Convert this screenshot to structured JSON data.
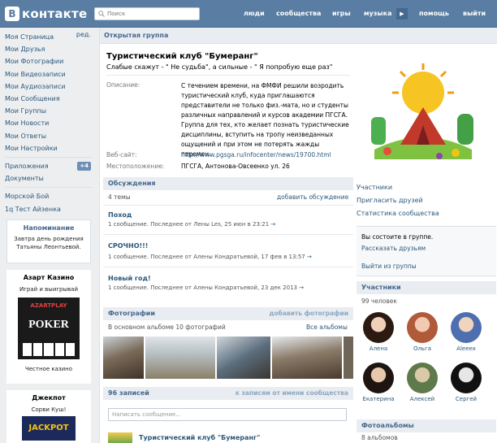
{
  "header": {
    "logo_letter": "В",
    "logo_text": "контакте",
    "search_placeholder": "Поиск",
    "nav": [
      "люди",
      "сообщества",
      "игры",
      "музыка",
      "помощь",
      "выйти"
    ]
  },
  "sidebar": {
    "items": [
      "Моя Страница",
      "Мои Друзья",
      "Мои Фотографии",
      "Мои Видеозаписи",
      "Мои Аудиозаписи",
      "Мои Сообщения",
      "Мои Группы",
      "Мои Новости",
      "Мои Ответы",
      "Мои Настройки"
    ],
    "edit_label": "ред.",
    "apps": [
      "Приложения",
      "Документы"
    ],
    "apps_badge": "+4",
    "games": [
      "Морской Бой",
      "1q Тест Айзенка"
    ],
    "reminder_title": "Напоминание",
    "reminder_text": "Завтра день рождения Татьяны Леонтьевой.",
    "ad1_title": "Азарт Казино",
    "ad1_sub": "Играй и выигрывай",
    "ad1_banner_top": "AZARTPLAY",
    "ad1_banner": "POKER",
    "ad1_caption": "Честное казино",
    "ad2_title": "Джекпот",
    "ad2_sub": "Сорви Куш!",
    "ad2_banner": "JACKPOT"
  },
  "group": {
    "header": "Открытая группа",
    "title": "Туристический клуб \"Бумеранг\"",
    "status": "Слабые скажут - \" Не судьба\", а сильные - \" Я попробую еще раз\"",
    "desc_label": "Описание:",
    "description": "С течением времени, на ФМФИ решили возродить туристический клуб, куда приглашаются представители не только физ.-мата, но и студенты различных направлений и курсов академии ПГСГА. Группа для тех, кто желает познать туристические дисциплины, вступить на тропу неизведанных ощущений и при этом не потерять жажды перемен.",
    "site_label": "Веб-сайт:",
    "site": "http://www.pgsga.ru/infocenter/news/19700.html",
    "loc_label": "Местоположение:",
    "location": "ПГСГА, Антонова-Овсеенко ул. 26"
  },
  "discussions": {
    "title": "Обсуждения",
    "count": "4 темы",
    "action": "добавить обсуждение",
    "topics": [
      {
        "title": "Поход",
        "meta": "1 сообщение. Последнее от Лены Les, 25 июн в 23:21",
        "arrow": "→"
      },
      {
        "title": "СРОЧНО!!!",
        "meta": "1 сообщение. Последнее от Алены Кондратьевой, 17 фев в 13:57",
        "arrow": "→"
      },
      {
        "title": "Новый год!",
        "meta": "1 сообщение. Последнее от Алены Кондратьевой, 23 дек 2013",
        "arrow": "→"
      }
    ]
  },
  "photos": {
    "title": "Фотографии",
    "action": "добавить фотографии",
    "sub": "В основном альбоме 10 фотографий",
    "all": "Все альбомы"
  },
  "wall": {
    "title": "96 записей",
    "action": "к записям от имени сообщества",
    "placeholder": "Написать сообщение...",
    "post_author": "Туристический клуб \"Бумеранг\""
  },
  "right": {
    "links": [
      "Участники",
      "Пригласить друзей",
      "Статистика сообщества"
    ],
    "membership": [
      "Вы состоите в группе.",
      "Рассказать друзьям"
    ],
    "leave": "Выйти из группы",
    "members_title": "Участники",
    "members_count": "99 человек",
    "members": [
      "Алена",
      "Ольга",
      "Aleeex",
      "Екатерина",
      "Алексей",
      "Сергей"
    ],
    "albums_title": "Фотоальбомы",
    "albums_count": "8 альбомов"
  }
}
